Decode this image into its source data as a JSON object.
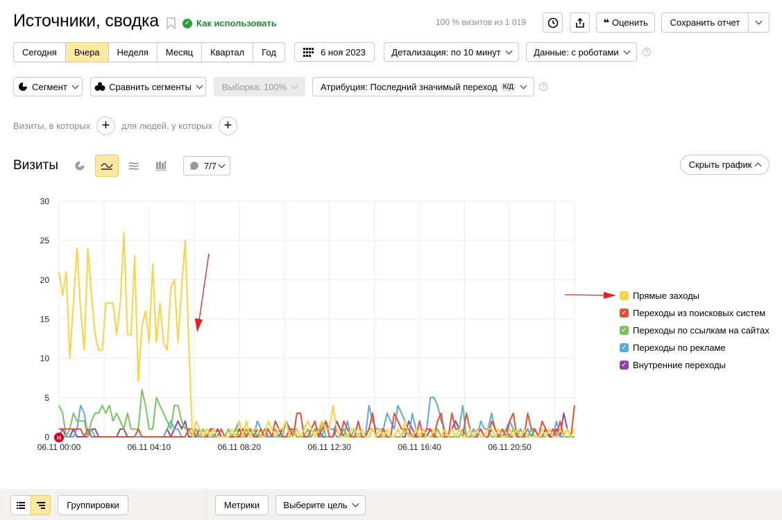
{
  "header": {
    "title": "Источники, сводка",
    "howto_label": "Как использовать",
    "visits_share": "100 % визитов из 1 019",
    "rate_label": "Оценить",
    "save_label": "Сохранить отчет"
  },
  "period": {
    "options": [
      "Сегодня",
      "Вчера",
      "Неделя",
      "Месяц",
      "Квартал",
      "Год"
    ],
    "active": "Вчера",
    "date": "6 ноя 2023",
    "detail": "Детализация: по 10 минут",
    "data_mode": "Данные: с роботами"
  },
  "filters": {
    "segment": "Сегмент",
    "compare": "Сравнить сегменты",
    "sample": "Выборка: 100%",
    "attribution": "Атрибуция: Последний значимый переход",
    "attribution_badge": "К/Д",
    "visits_hint": "Визиты, в которых",
    "people_hint": "для людей, у которых"
  },
  "chart_section": {
    "title": "Визиты",
    "series_counter": "7/7",
    "hide_label": "Скрыть график"
  },
  "footer": {
    "groupings": "Группировки",
    "metrics": "Метрики",
    "goal": "Выберите цель"
  },
  "colors": {
    "accent": "#fde9a0",
    "green": "#1a8e2a",
    "annotation_arrow": "#e3231b"
  },
  "chart_data": {
    "type": "line",
    "title": "",
    "ylim": [
      0,
      30
    ],
    "yticks": [
      0,
      5,
      10,
      15,
      20,
      25,
      30
    ],
    "xticks": [
      "06.11 00:00",
      "06.11 04:10",
      "06.11 08:20",
      "06.11 12:30",
      "06.11 16:40",
      "06.11 20:50"
    ],
    "x_interval_minutes": 10,
    "marker_label": "Н",
    "grid": true,
    "legend_position": "right",
    "series": [
      {
        "name": "Прямые заходы",
        "color": "#fcd33c",
        "values": [
          21,
          18,
          21,
          10,
          17,
          24,
          16,
          11,
          24,
          18,
          13,
          11,
          11,
          17,
          17,
          17,
          13,
          17,
          26,
          13,
          13,
          23,
          7,
          14,
          16,
          12,
          22,
          12,
          17,
          12,
          11,
          19,
          20,
          12,
          19,
          25,
          12,
          0,
          2,
          1,
          0,
          1,
          0,
          1,
          0,
          0,
          0,
          0,
          1,
          0,
          2,
          0,
          2,
          0,
          1,
          1,
          0,
          0,
          2,
          1,
          0,
          1,
          1,
          2,
          0,
          0,
          1,
          0,
          1,
          2,
          1,
          0,
          1,
          2,
          1,
          1,
          4,
          1,
          0,
          0,
          0,
          1,
          1,
          0,
          1,
          0,
          0,
          1,
          0,
          1,
          0,
          1,
          0,
          0,
          1,
          0,
          2,
          0,
          0,
          1,
          0,
          1,
          0,
          0,
          1,
          0,
          0,
          1,
          0,
          1,
          0,
          1,
          0,
          0,
          1,
          0,
          1,
          0,
          0,
          1,
          1,
          0,
          1,
          0,
          0,
          1,
          0,
          1,
          0,
          1,
          0,
          0,
          0,
          0,
          1,
          0,
          1,
          0,
          0,
          1,
          0,
          1,
          0,
          1
        ]
      },
      {
        "name": "Переходы из поисковых систем",
        "color": "#f04b2f",
        "values": [
          0,
          1,
          1,
          1,
          1,
          1,
          1,
          0,
          1,
          0,
          0,
          0,
          0,
          0,
          0,
          0,
          0,
          0,
          0,
          0,
          0,
          0,
          1,
          0,
          0,
          0,
          0,
          0,
          0,
          0,
          0,
          0,
          0,
          0,
          0,
          0,
          1,
          1,
          0,
          1,
          0,
          0,
          1,
          1,
          0,
          1,
          0,
          0,
          0,
          0,
          0,
          1,
          0,
          1,
          0,
          0,
          1,
          0,
          1,
          0,
          2,
          1,
          0,
          0,
          1,
          0,
          3,
          3,
          0,
          0,
          1,
          2,
          0,
          1,
          2,
          0,
          0,
          1,
          0,
          2,
          1,
          0,
          0,
          2,
          0,
          0,
          1,
          3,
          0,
          0,
          1,
          0,
          0,
          3,
          2,
          1,
          1,
          1,
          0,
          0,
          2,
          0,
          1,
          1,
          0,
          2,
          3,
          0,
          0,
          3,
          1,
          1,
          0,
          3,
          1,
          0,
          0,
          1,
          0,
          0,
          2,
          1,
          0,
          1,
          0,
          2,
          3,
          0,
          0,
          0,
          3,
          1,
          1,
          0,
          2,
          1,
          0,
          1,
          0,
          2,
          0,
          1,
          0,
          4
        ]
      },
      {
        "name": "Переходы по ссылкам на сайтах",
        "color": "#7ac35c",
        "values": [
          4,
          3,
          0,
          1,
          3,
          2,
          2,
          2,
          0,
          2,
          3,
          3,
          4,
          3,
          4,
          2,
          3,
          2,
          1,
          3,
          1,
          1,
          1,
          6,
          4,
          1,
          1,
          5,
          4,
          3,
          2,
          1,
          4,
          4,
          2,
          1,
          1,
          0,
          1,
          0,
          1,
          0,
          1,
          0,
          0,
          0,
          0,
          1,
          0,
          1,
          0,
          0,
          1,
          0,
          1,
          0,
          0,
          1,
          1,
          0,
          1,
          0,
          0,
          2,
          0,
          1,
          0,
          0,
          0,
          1,
          0,
          1,
          0,
          2,
          0,
          0,
          0,
          1,
          0,
          1,
          0,
          0,
          1,
          0,
          0,
          0,
          1,
          1,
          0,
          0,
          0,
          0,
          0,
          0,
          0,
          0,
          1,
          0,
          0,
          1,
          0,
          0,
          0,
          0,
          0,
          1,
          0,
          0,
          0,
          0,
          0,
          0,
          1,
          0,
          0,
          0,
          1,
          0,
          0,
          1,
          0,
          0,
          0,
          0,
          0,
          0,
          1,
          0,
          0,
          0,
          0,
          1,
          0,
          0,
          0,
          0,
          1,
          0,
          0,
          1,
          0,
          0,
          0,
          0
        ]
      },
      {
        "name": "Переходы по рекламе",
        "color": "#5aa8e2",
        "values": [
          0,
          0,
          0,
          0,
          0,
          1,
          4,
          3,
          0,
          1,
          0,
          0,
          0,
          0,
          0,
          0,
          0,
          0,
          0,
          0,
          0,
          0,
          0,
          0,
          0,
          0,
          0,
          0,
          0,
          0,
          1,
          2,
          1,
          1,
          0,
          0,
          1,
          0,
          0,
          0,
          0,
          0,
          0,
          0,
          0,
          0,
          0,
          0,
          0,
          1,
          2,
          0,
          0,
          1,
          0,
          2,
          1,
          0,
          0,
          0,
          0,
          0,
          0,
          0,
          0,
          1,
          1,
          0,
          0,
          0,
          0,
          1,
          0,
          0,
          2,
          1,
          1,
          0,
          0,
          0,
          2,
          0,
          0,
          0,
          1,
          0,
          4,
          2,
          1,
          1,
          1,
          3,
          2,
          1,
          4,
          3,
          2,
          0,
          3,
          1,
          0,
          0,
          1,
          5,
          5,
          4,
          2,
          1,
          0,
          1,
          0,
          1,
          4,
          0,
          0,
          1,
          0,
          2,
          1,
          1,
          3,
          1,
          0,
          0,
          1,
          2,
          1,
          0,
          1,
          0,
          1,
          0,
          0,
          0,
          0,
          0,
          1,
          0,
          2,
          0,
          0,
          1,
          0,
          0
        ]
      },
      {
        "name": "Внутренние переходы",
        "color": "#8e42a6",
        "values": [
          1,
          1,
          0,
          0,
          1,
          0,
          0,
          0,
          0,
          1,
          1,
          0,
          0,
          0,
          0,
          0,
          0,
          1,
          1,
          0,
          0,
          0,
          0,
          0,
          0,
          0,
          0,
          0,
          0,
          0,
          1,
          0,
          1,
          2,
          1,
          2,
          0,
          0,
          1,
          0,
          0,
          0,
          0,
          0,
          1,
          0,
          0,
          0,
          0,
          0,
          1,
          0,
          0,
          1,
          0,
          1,
          0,
          1,
          0,
          0,
          1,
          0,
          1,
          2,
          1,
          1,
          0,
          0,
          0,
          0,
          0,
          1,
          1,
          0,
          0,
          0,
          0,
          2,
          1,
          0,
          0,
          0,
          1,
          0,
          0,
          0,
          0,
          1,
          0,
          0,
          1,
          0,
          0,
          0,
          1,
          0,
          0,
          2,
          1,
          0,
          0,
          1,
          0,
          1,
          0,
          0,
          0,
          1,
          0,
          1,
          2,
          1,
          0,
          0,
          0,
          0,
          0,
          1,
          0,
          0,
          1,
          0,
          1,
          0,
          1,
          0,
          0,
          1,
          0,
          0,
          1,
          0,
          1,
          0,
          0,
          1,
          0,
          0,
          1,
          0,
          3,
          1,
          0,
          0
        ]
      }
    ]
  }
}
